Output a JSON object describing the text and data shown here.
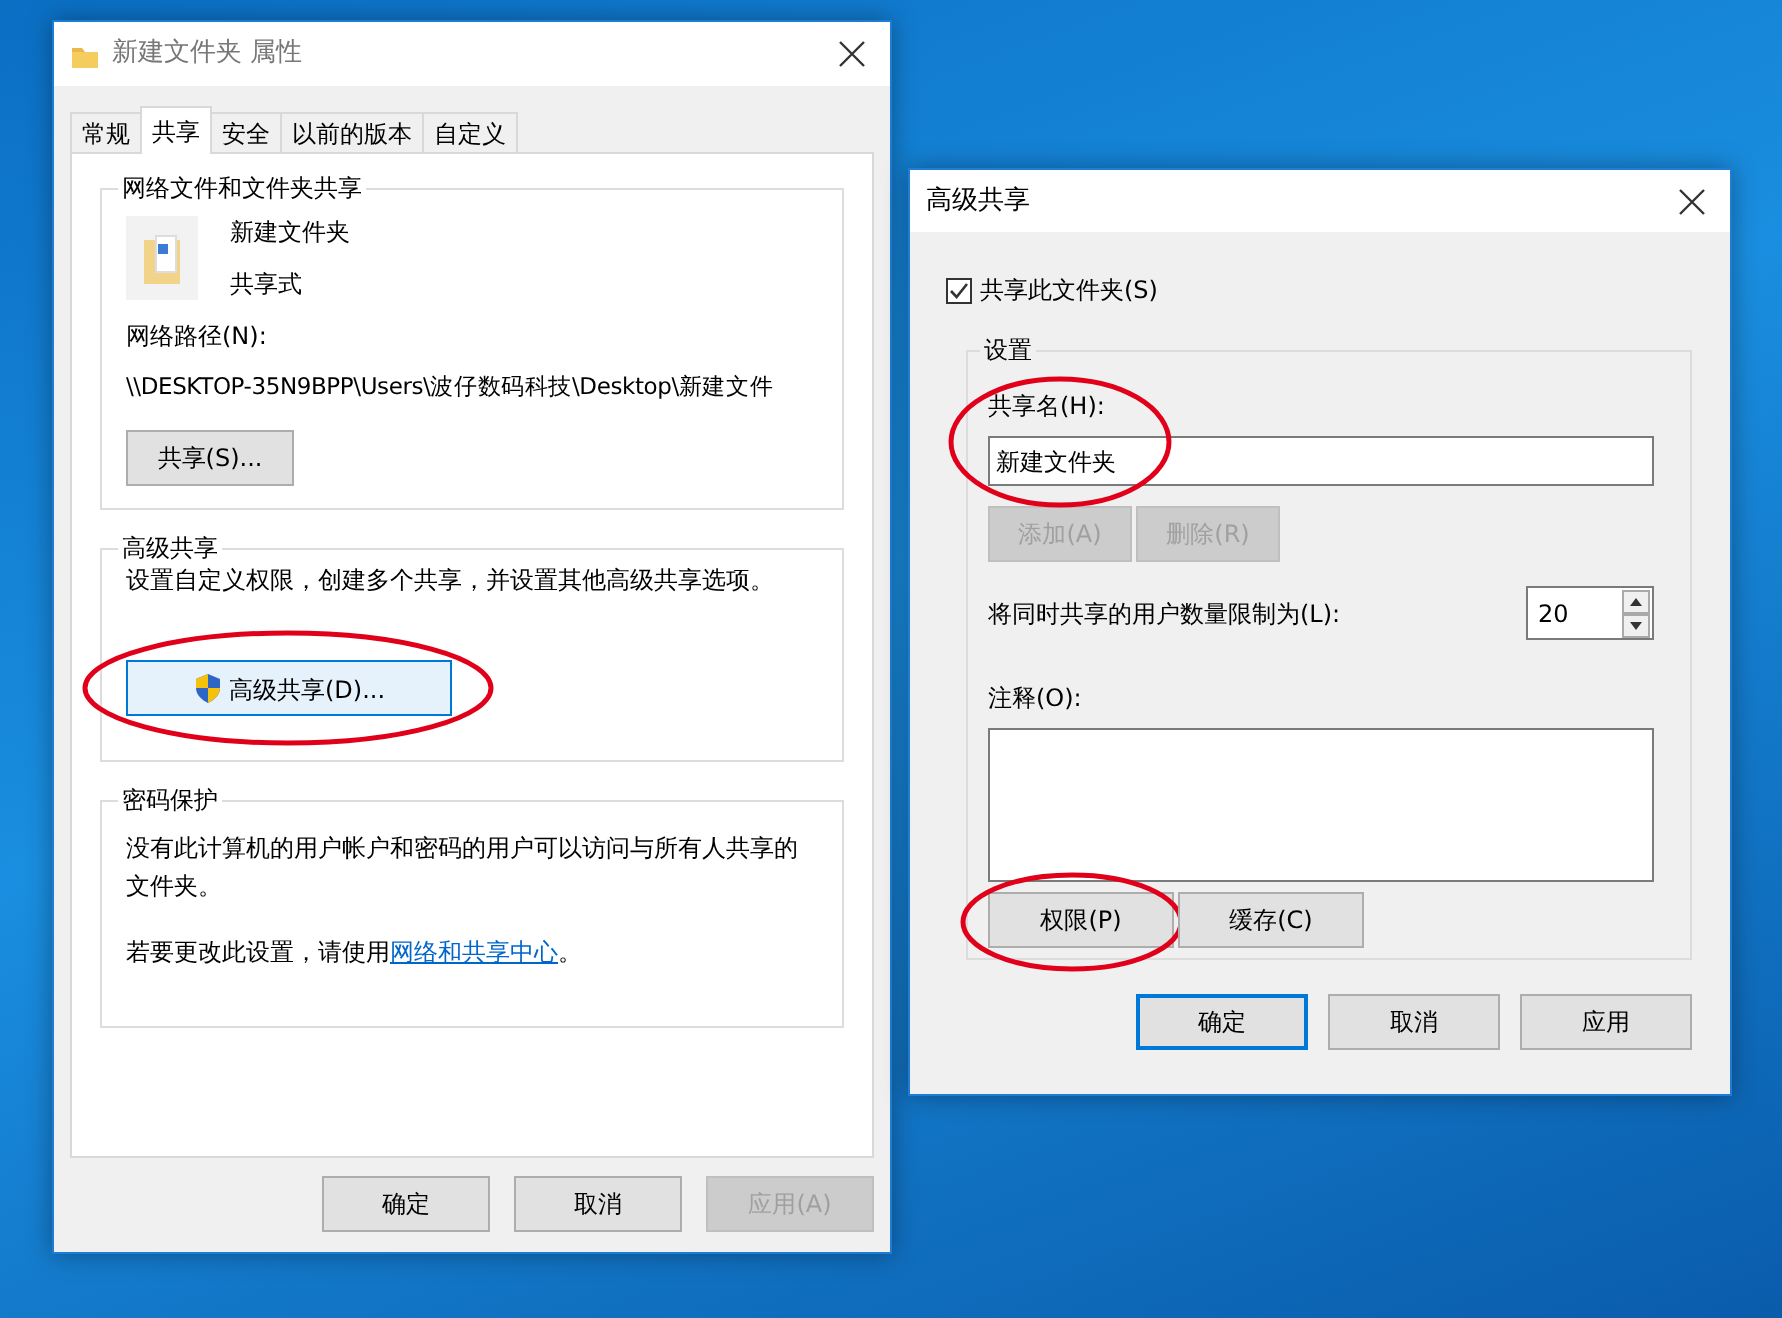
{
  "properties_dialog": {
    "title": "新建文件夹 属性",
    "tabs": [
      {
        "label": "常规",
        "selected": false
      },
      {
        "label": "共享",
        "selected": true
      },
      {
        "label": "安全",
        "selected": false
      },
      {
        "label": "以前的版本",
        "selected": false
      },
      {
        "label": "自定义",
        "selected": false
      }
    ],
    "network_sharing": {
      "heading": "网络文件和文件夹共享",
      "folder_name": "新建文件夹",
      "share_status": "共享式",
      "path_label": "网络路径(N):",
      "path": "\\\\DESKTOP-35N9BPP\\Users\\波仔数码科技\\Desktop\\新建文件",
      "share_button": {
        "label": "共享(S)...",
        "highlighted": false,
        "focused": false
      }
    },
    "advanced_sharing": {
      "heading": "高级共享",
      "description": "设置自定义权限，创建多个共享，并设置其他高级共享选项。",
      "button": {
        "label": "高级共享(D)...",
        "highlighted": true,
        "focused": true
      }
    },
    "password_protection": {
      "heading": "密码保护",
      "description": "没有此计算机的用户帐户和密码的用户可以访问与所有人共享的文件夹。",
      "change_text": "若要更改此设置，请使用",
      "link": "网络和共享中心",
      "suffix": "。"
    },
    "buttons": [
      {
        "label": "确定",
        "disabled": false,
        "default": false
      },
      {
        "label": "取消",
        "disabled": false,
        "default": false
      },
      {
        "label": "应用(A)",
        "disabled": true,
        "default": false
      }
    ]
  },
  "advanced_sharing_dialog": {
    "title": "高级共享",
    "share_checkbox": {
      "label": "共享此文件夹(S)",
      "checked": true
    },
    "settings": {
      "heading": "设置",
      "share_name_label": "共享名(H):",
      "share_name": "新建文件夹",
      "share_name_highlighted": true,
      "add_button": {
        "label": "添加(A)",
        "disabled": true
      },
      "remove_button": {
        "label": "删除(R)",
        "disabled": true
      },
      "user_limit_label": "将同时共享的用户数量限制为(L):",
      "user_limit": "20",
      "comment_label": "注释(O):",
      "permissions_button": {
        "label": "权限(P)",
        "highlighted": true
      },
      "caching_button": {
        "label": "缓存(C)",
        "highlighted": false
      }
    },
    "buttons": [
      {
        "label": "确定",
        "disabled": false,
        "default": true
      },
      {
        "label": "取消",
        "disabled": false,
        "default": false
      },
      {
        "label": "应用",
        "disabled": false,
        "default": false
      }
    ]
  }
}
